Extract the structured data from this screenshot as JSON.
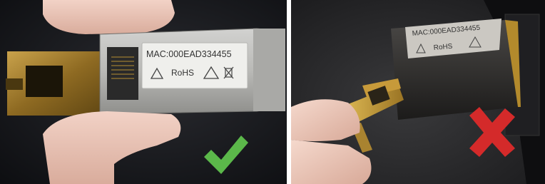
{
  "figure": {
    "left_photo": {
      "label_mac": "MAC:000EAD334455",
      "label_rohs": "RoHS",
      "verdict": "correct",
      "verdict_color": "#5bb84a"
    },
    "right_photo": {
      "label_mac": "MAC:000EAD334455",
      "label_rohs": "RoHS",
      "verdict": "incorrect",
      "verdict_color": "#d42a2a"
    }
  }
}
